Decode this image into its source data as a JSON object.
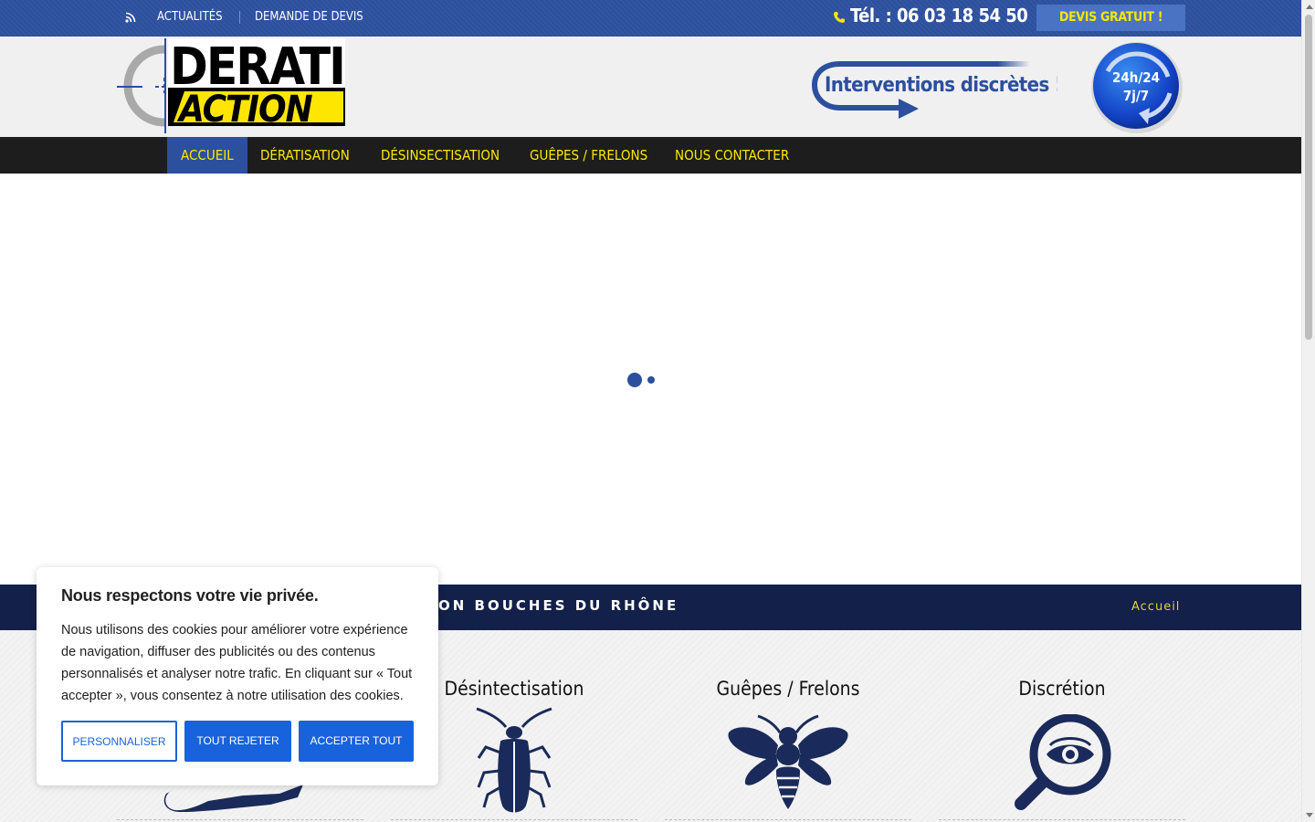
{
  "topbar": {
    "links": [
      "ACTUALITÉS",
      "DEMANDE DE DEVIS"
    ],
    "phone": "Tél. : 06 03 18 54 50",
    "cta": "DEVIS GRATUIT !"
  },
  "header": {
    "logo_line1": "DERATI",
    "logo_line2": "ACTION",
    "slogan": "Interventions discrètes !",
    "badge_line1": "24h/24",
    "badge_line2": "7j/7"
  },
  "nav": {
    "items": [
      "ACCUEIL",
      "DÉRATISATION",
      "DÉSINSECTISATION",
      "GUÊPES / FRELONS",
      "NOUS CONTACTER"
    ]
  },
  "band": {
    "title": "ON BOUCHES DU RHÔNE",
    "breadcrumb": "Accueil"
  },
  "services": [
    {
      "title": "",
      "icon": "rat-icon"
    },
    {
      "title": "Désintectisation",
      "icon": "cockroach-icon"
    },
    {
      "title": "Guêpes / Frelons",
      "icon": "wasp-icon"
    },
    {
      "title": "Discrétion",
      "icon": "magnifier-eye-icon"
    }
  ],
  "cookie": {
    "title": "Nous respectons votre vie privée.",
    "text": "Nous utilisons des cookies pour améliorer votre expérience de navigation, diffuser des publicités ou des contenus personnalisés et analyser notre trafic. En cliquant sur « Tout accepter », vous consentez à notre utilisation des cookies.",
    "customize": "PERSONNALISER",
    "reject": "TOUT REJETER",
    "accept": "ACCEPTER TOUT"
  },
  "colors": {
    "brand_blue": "#2c4f9e",
    "accent_yellow": "#ffe600",
    "navy": "#12204a",
    "cookie_blue": "#1863dc"
  }
}
